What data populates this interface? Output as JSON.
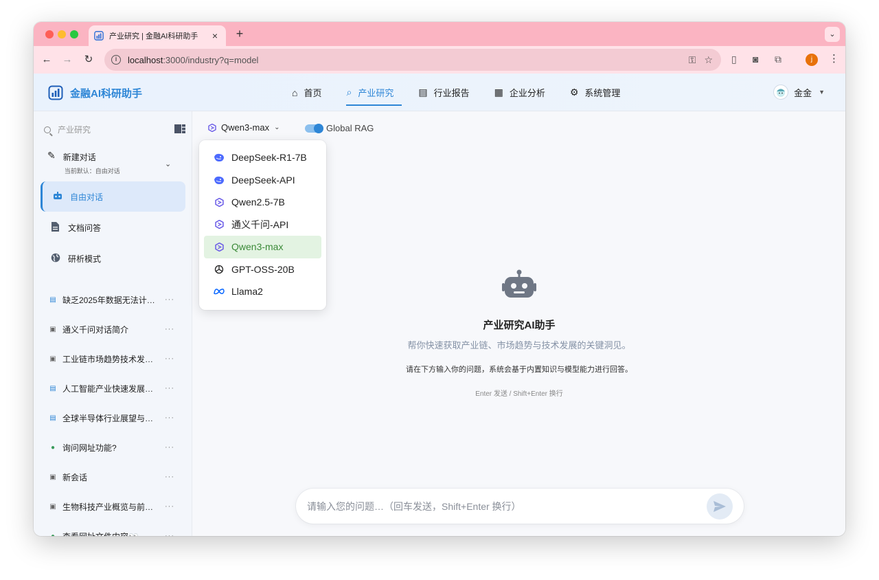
{
  "browser": {
    "tab_title": "产业研究 | 金融AI科研助手",
    "new_tab": "+",
    "url_host": "localhost",
    "url_path": ":3000/industry?q=model",
    "profile_initial": "j"
  },
  "app": {
    "logo_text": "金融AI科研助手",
    "nav": [
      {
        "label": "首页",
        "icon": "home-icon"
      },
      {
        "label": "产业研究",
        "icon": "search-icon"
      },
      {
        "label": "行业报告",
        "icon": "document-icon"
      },
      {
        "label": "企业分析",
        "icon": "building-icon"
      },
      {
        "label": "系统管理",
        "icon": "gear-icon"
      }
    ],
    "active_nav": "产业研究",
    "user_name": "金金",
    "accent_color": "#2e86d6"
  },
  "sidebar": {
    "search_placeholder": "产业研究",
    "new_chat_title": "新建对话",
    "new_chat_sub": "当前默认：自由对话",
    "modes": [
      {
        "label": "自由对话",
        "icon": "robot-icon",
        "active": true
      },
      {
        "label": "文档问答",
        "icon": "document-icon",
        "active": false
      },
      {
        "label": "研析模式",
        "icon": "globe-icon",
        "active": false
      }
    ],
    "history": [
      {
        "label": "缺乏2025年数据无法计…",
        "icon": "document-icon"
      },
      {
        "label": "通义千问对话简介",
        "icon": "robot-icon"
      },
      {
        "label": "工业链市场趋势技术发…",
        "icon": "robot-icon"
      },
      {
        "label": "人工智能产业快速发展…",
        "icon": "document-icon"
      },
      {
        "label": "全球半导体行业展望与…",
        "icon": "document-icon"
      },
      {
        "label": "询问网址功能?",
        "icon": "globe-icon"
      },
      {
        "label": "新会话",
        "icon": "robot-icon"
      },
      {
        "label": "生物科技产业概览与前…",
        "icon": "robot-icon"
      },
      {
        "label": "查看网址文件内容👀",
        "icon": "globe-icon"
      }
    ],
    "more_label": "···"
  },
  "main": {
    "model_selected": "Qwen3-max",
    "rag_label": "Global RAG",
    "rag_enabled": true,
    "models": [
      {
        "label": "DeepSeek-R1-7B",
        "icon": "deepseek-icon"
      },
      {
        "label": "DeepSeek-API",
        "icon": "deepseek-icon"
      },
      {
        "label": "Qwen2.5-7B",
        "icon": "qwen-icon"
      },
      {
        "label": "通义千问-API",
        "icon": "qwen-icon"
      },
      {
        "label": "Qwen3-max",
        "icon": "qwen-icon",
        "selected": true
      },
      {
        "label": "GPT-OSS-20B",
        "icon": "openai-icon"
      },
      {
        "label": "Llama2",
        "icon": "meta-icon"
      }
    ],
    "hero_title": "产业研究AI助手",
    "hero_sub": "帮你快速获取产业链、市场趋势与技术发展的关键洞见。",
    "hero_desc": "请在下方输入你的问题，系统会基于内置知识与模型能力进行回答。",
    "hero_hint": "Enter 发送 / Shift+Enter 换行",
    "input_placeholder": "请输入您的问题…（回车发送，Shift+Enter 换行）"
  }
}
